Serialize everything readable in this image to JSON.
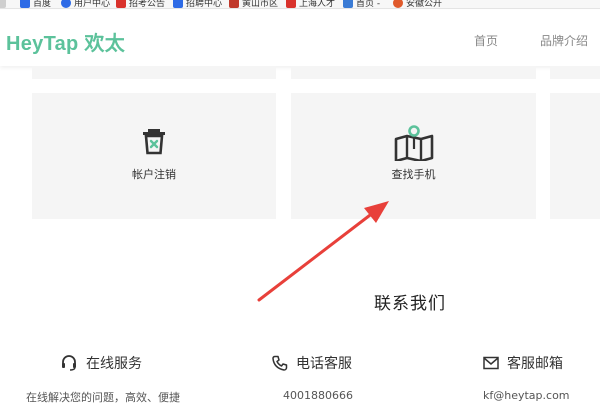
{
  "bookmarks": [
    {
      "label": "百度",
      "color": "#2e6be6"
    },
    {
      "label": "用户中心",
      "color": "#2e6be6"
    },
    {
      "label": "招考公告",
      "color": "#d9322c"
    },
    {
      "label": "招聘中心",
      "color": "#2e6be6"
    },
    {
      "label": "黄山市区",
      "color": "#c0392b"
    },
    {
      "label": "上海人才",
      "color": "#d9322c"
    },
    {
      "label": "首页 -",
      "color": "#3a7bd5"
    },
    {
      "label": "安徽公开",
      "color": "#e05a2b"
    }
  ],
  "header": {
    "logo_text": "HeyTap 欢太",
    "nav": [
      "首页",
      "品牌介绍"
    ]
  },
  "cards": [
    {
      "label": "帐户注销",
      "icon": "trash-icon"
    },
    {
      "label": "查找手机",
      "icon": "map-pin-icon"
    }
  ],
  "contact": {
    "title": "联系我们",
    "services": [
      {
        "label": "在线服务",
        "icon": "headset-icon",
        "sub": "在线解决您的问题，高效、便捷"
      },
      {
        "label": "电话客服",
        "icon": "phone-icon",
        "sub": "4001880666"
      },
      {
        "label": "客服邮箱",
        "icon": "mail-icon",
        "sub": "kf@heytap.com"
      }
    ]
  },
  "colors": {
    "brand": "#5cc29b",
    "arrow": "#e8403a",
    "card_bg": "#f5f5f5"
  }
}
